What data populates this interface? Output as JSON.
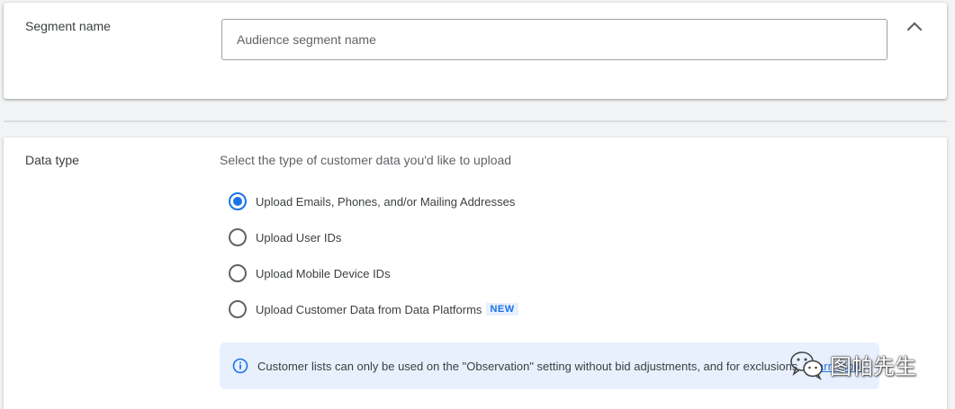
{
  "segment": {
    "label": "Segment name",
    "placeholder": "Audience segment name",
    "value": "",
    "collapse_icon": "chevron-up-icon"
  },
  "data_type": {
    "label": "Data type",
    "description": "Select the type of customer data you'd like to upload",
    "options": [
      {
        "label": "Upload Emails, Phones, and/or Mailing Addresses",
        "selected": true
      },
      {
        "label": "Upload User IDs",
        "selected": false
      },
      {
        "label": "Upload Mobile Device IDs",
        "selected": false
      },
      {
        "label": "Upload Customer Data from Data Platforms",
        "selected": false,
        "badge": "NEW"
      }
    ],
    "info": {
      "icon": "info-icon",
      "text": "Customer lists can only be used on the \"Observation\" setting without bid adjustments, and for exclusions. ",
      "link": "Learn more"
    }
  },
  "watermark": {
    "text": "图帕先生",
    "icon": "wechat-icon"
  },
  "colors": {
    "accent": "#1a73e8",
    "info_bg": "#e8f0fe",
    "page_bg": "#f1f3f4"
  }
}
